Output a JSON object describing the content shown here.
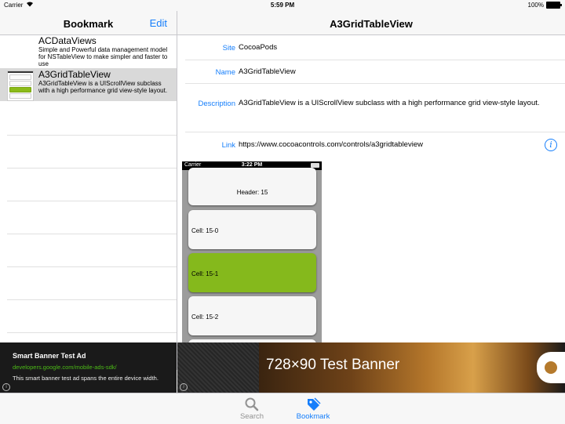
{
  "status_bar": {
    "carrier": "Carrier",
    "time": "5:59 PM",
    "battery": "100%"
  },
  "left_nav": {
    "title": "Bookmark",
    "edit_label": "Edit"
  },
  "right_nav": {
    "title": "A3GridTableView"
  },
  "list": [
    {
      "title": "ACDataViews",
      "description": "Simple and Powerful data management model for NSTableView to make simpler and faster to use"
    },
    {
      "title": "A3GridTableView",
      "description": "A3GridTableView is a UIScrollView subclass with a high performance grid view-style layout."
    }
  ],
  "detail": {
    "site_label": "Site",
    "site_value": "CocoaPods",
    "name_label": "Name",
    "name_value": "A3GridTableView",
    "description_label": "Description",
    "description_value": "A3GridTableView is a UIScrollView subclass with a high performance grid view-style layout.",
    "link_label": "Link",
    "link_value": "https://www.cocoacontrols.com/controls/a3gridtableview"
  },
  "preview": {
    "carrier": "Carrier",
    "time": "3:22 PM",
    "header": "Header: 15",
    "cells": [
      "Cell: 15-0",
      "Cell: 15-1",
      "Cell: 15-2"
    ]
  },
  "ad_left": {
    "title": "Smart Banner Test Ad",
    "url": "developers.google.com/mobile-ads-sdk/",
    "description": "This smart banner test ad spans the entire device width."
  },
  "ad_right": {
    "text": "728×90   Test Banner"
  },
  "tabbar": {
    "search_label": "Search",
    "bookmark_label": "Bookmark"
  },
  "colors": {
    "accent": "#157efb",
    "selected_row": "#d9d9d9",
    "green_cell": "#85b91c"
  }
}
